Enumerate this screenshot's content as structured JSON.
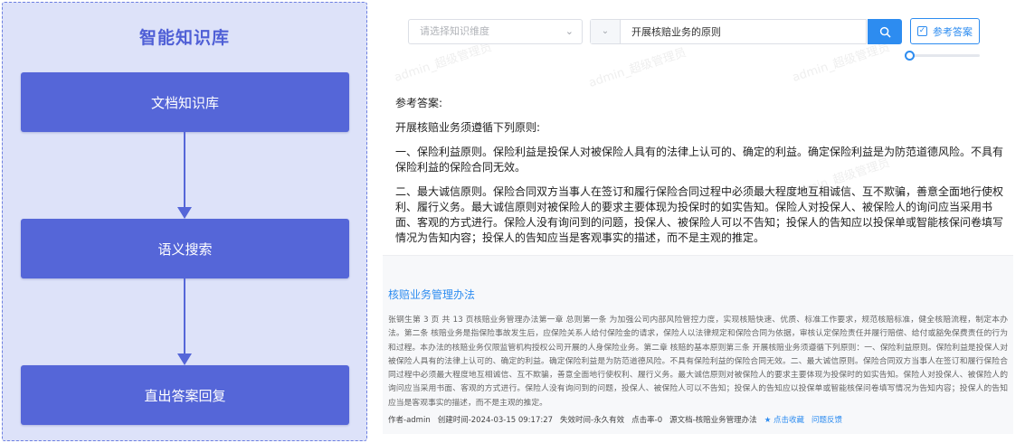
{
  "flow": {
    "title": "智能知识库",
    "steps": [
      "文档知识库",
      "语义搜索",
      "直出答案回复"
    ]
  },
  "toolbar": {
    "dimension_placeholder": "请选择知识维度",
    "query_value": "开展核赔业务的原则",
    "reference_label": "参考答案",
    "reference_checked": true,
    "slider_level": 0
  },
  "watermark": {
    "text": "admin_超级管理员"
  },
  "answer": {
    "heading": "参考答案:",
    "intro": "开展核赔业务须遵循下列原则:",
    "p1": "一、保险利益原则。保险利益是投保人对被保险人具有的法律上认可的、确定的利益。确定保险利益是为防范道德风险。不具有保险利益的保险合同无效。",
    "p2": "二、最大诚信原则。保险合同双方当事人在签订和履行保险合同过程中必须最大程度地互相诚信、互不欺骗，善意全面地行使权利、履行义务。最大诚信原则对被保险人的要求主要体现为投保时的如实告知。保险人对投保人、被保险人的询问应当采用书面、客观的方式进行。保险人没有询问到的问题，投保人、被保险人可以不告知；投保人的告知应以投保单或智能核保问卷填写情况为告知内容；投保人的告知应当是客观事实的描述，而不是主观的推定。"
  },
  "result": {
    "title": "核赔业务管理办法",
    "body": "张钢生第 3 页 共 13 页核赔业务管理办法第一章 总则第一条 为加强公司内部风险管控力度，实现核赔快速、优质、标准工作要求，规范核赔标准，健全核赔流程，制定本办法。第二条 核赔业务是指保险事故发生后，应保险关系人给付保险金的请求，保险人以法律规定和保险合同为依据，审核认定保险责任并履行赔偿、给付或豁免保费责任的行为和过程。本办法的核赔业务仅限监管机构授权公司开展的人身保险业务。第二章 核赔的基本原则第三条 开展核赔业务须遵循下列原则：一、保险利益原则。保险利益是投保人对被保险人具有的法律上认可的、确定的利益。确定保险利益是为防范道德风险。不具有保险利益的保险合同无效。二、最大诚信原则。保险合同双方当事人在签订和履行保险合同过程中必须最大程度地互相诚信、互不欺骗，善意全面地行使权利、履行义务。最大诚信原则对被保险人的要求主要体现为投保时的如实告知。保险人对投保人、被保险人的询问应当采用书面、客观的方式进行。保险人没有询问到的问题，投保人、被保险人可以不告知；投保人的告知应以投保单或智能核保问卷填写情况为告知内容；投保人的告知应当是客观事实的描述，而不是主观的推定。",
    "meta": {
      "author": "作者-admin",
      "created": "创建时间-2024-03-15 09:17:27",
      "expiry": "失效时间-永久有效",
      "clicks": "点击率-0",
      "source": "源文档-核赔业务管理办法",
      "favorite": "点击收藏",
      "feedback": "问题反馈"
    }
  },
  "colors": {
    "flow_bg": "#dde2f9",
    "flow_box": "#5566d8",
    "flow_title": "#4f5fd6",
    "accent": "#2d8cf0"
  },
  "icons": [
    "chevron-down-icon",
    "search-icon",
    "checkbox-checked-icon",
    "star-icon"
  ]
}
